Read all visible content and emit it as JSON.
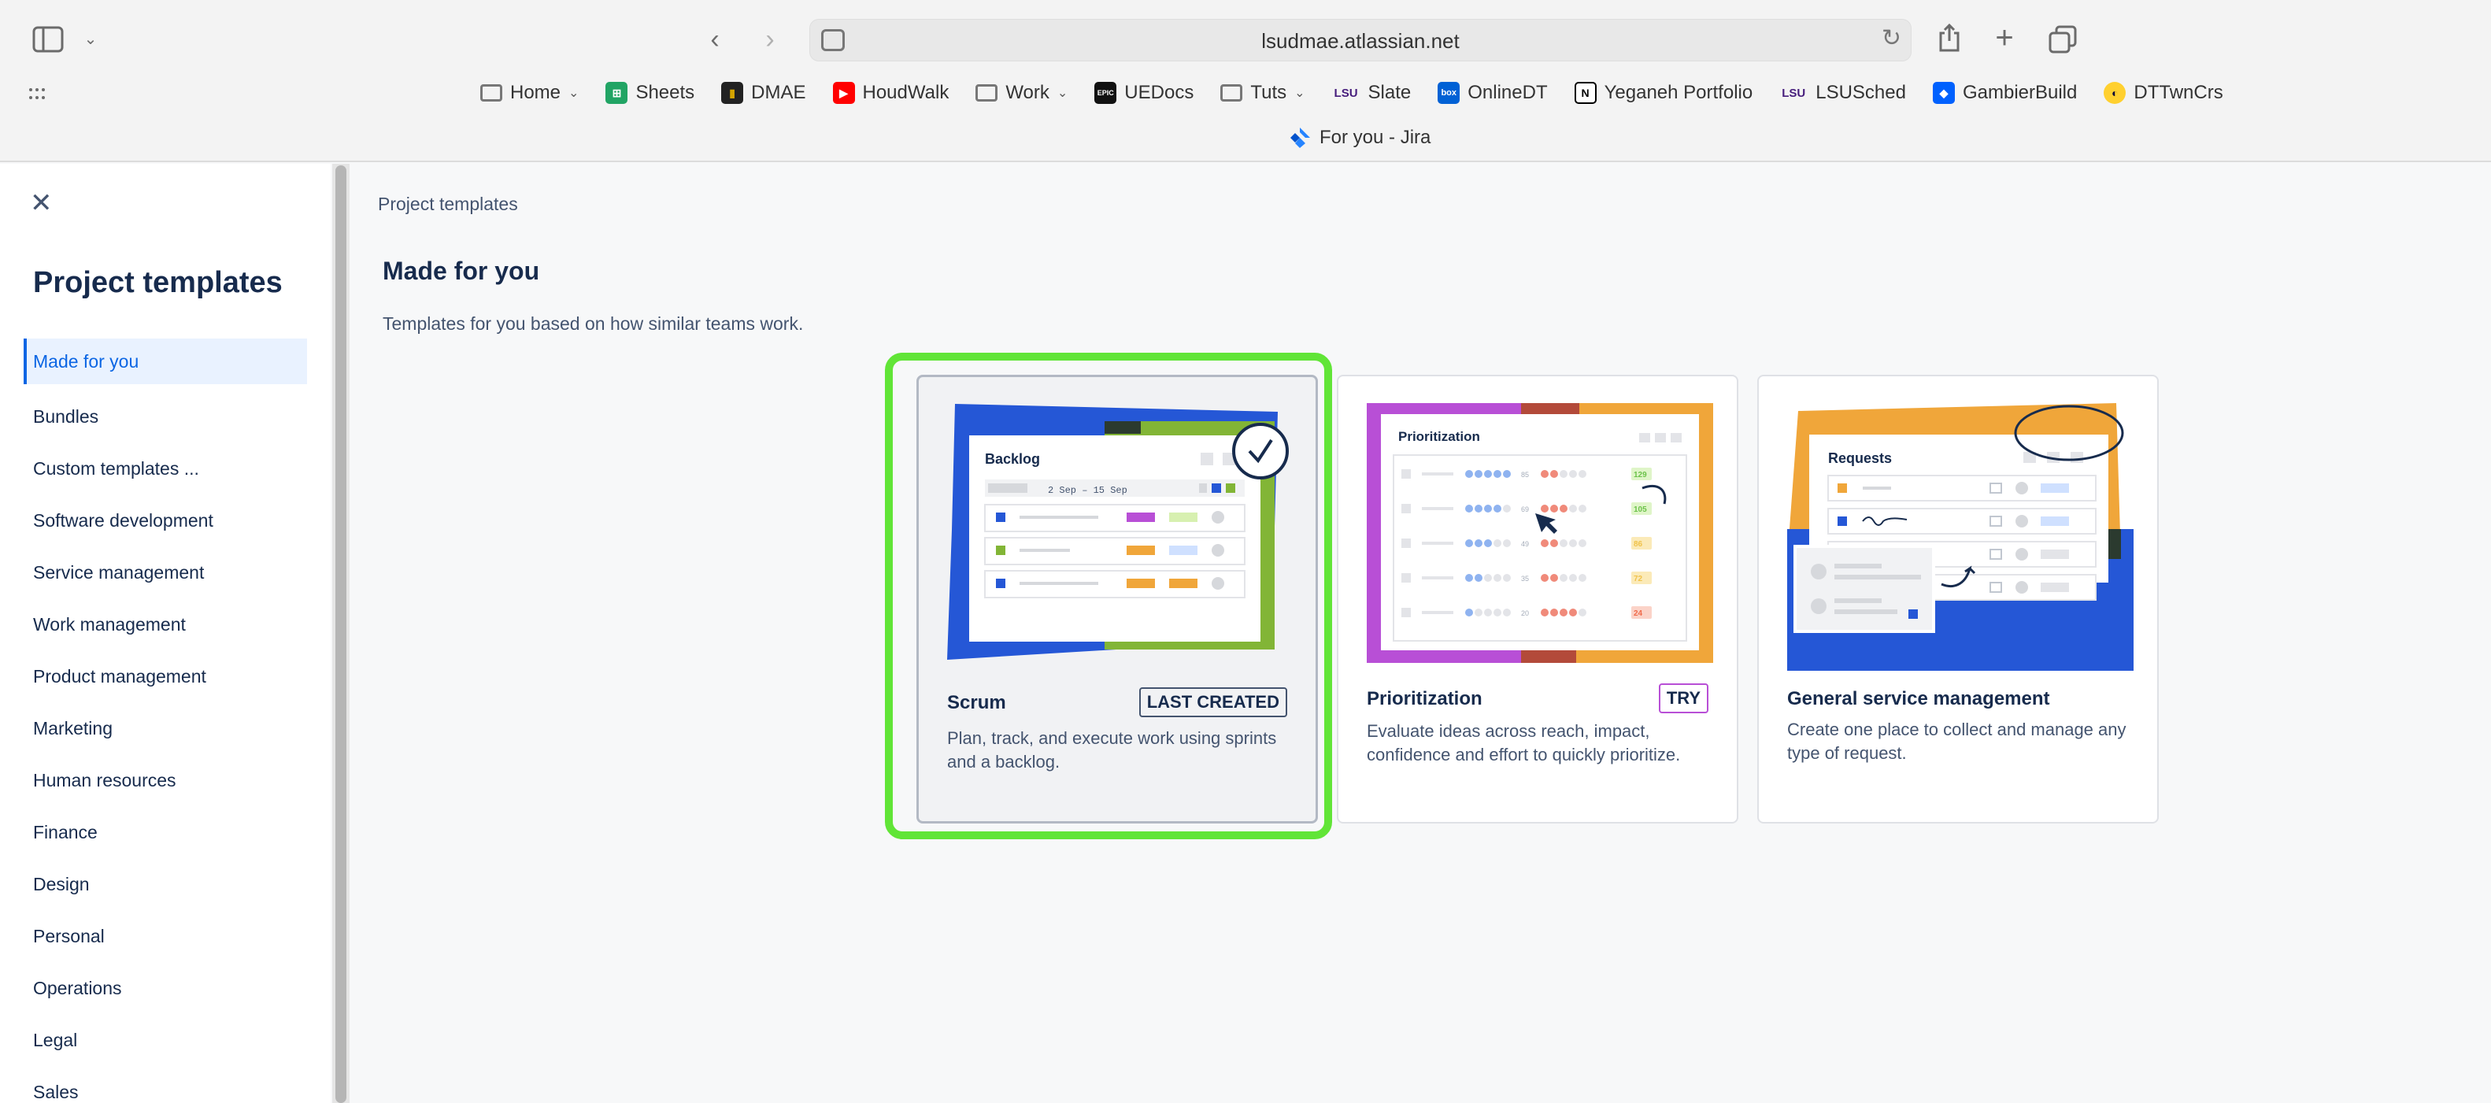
{
  "browser": {
    "url": "lsudmae.atlassian.net",
    "bookmarks": [
      {
        "label": "Home",
        "icon": "folder-icon",
        "has_menu": true
      },
      {
        "label": "Sheets",
        "icon": "sheets-icon",
        "has_menu": false
      },
      {
        "label": "DMAE",
        "icon": "dmae-icon",
        "has_menu": false
      },
      {
        "label": "HoudWalk",
        "icon": "youtube-icon",
        "has_menu": false
      },
      {
        "label": "Work",
        "icon": "folder-icon",
        "has_menu": true
      },
      {
        "label": "UEDocs",
        "icon": "epic-icon",
        "has_menu": false
      },
      {
        "label": "Tuts",
        "icon": "folder-icon",
        "has_menu": true
      },
      {
        "label": "Slate",
        "icon": "lsu-icon",
        "has_menu": false
      },
      {
        "label": "OnlineDT",
        "icon": "box-icon",
        "has_menu": false
      },
      {
        "label": "Yeganeh Portfolio",
        "icon": "notion-icon",
        "has_menu": false
      },
      {
        "label": "LSUSched",
        "icon": "lsu-icon",
        "has_menu": false
      },
      {
        "label": "GambierBuild",
        "icon": "dropbox-icon",
        "has_menu": false
      },
      {
        "label": "DTTwnCrs",
        "icon": "miro-icon",
        "has_menu": false
      }
    ],
    "tab_title": "For you - Jira"
  },
  "sidebar": {
    "title": "Project templates",
    "items": [
      {
        "label": "Made for you",
        "active": true
      },
      {
        "label": "Bundles"
      },
      {
        "label": "Custom templates ..."
      },
      {
        "label": "Software development"
      },
      {
        "label": "Service management"
      },
      {
        "label": "Work management"
      },
      {
        "label": "Product management"
      },
      {
        "label": "Marketing"
      },
      {
        "label": "Human resources"
      },
      {
        "label": "Finance"
      },
      {
        "label": "Design"
      },
      {
        "label": "Personal"
      },
      {
        "label": "Operations"
      },
      {
        "label": "Legal"
      },
      {
        "label": "Sales"
      }
    ]
  },
  "main": {
    "breadcrumb": "Project templates",
    "heading": "Made for you",
    "description": "Templates for you based on how similar teams work.",
    "cards": [
      {
        "name": "Scrum",
        "badge": "LAST CREATED",
        "description": "Plan, track, and execute work using sprints and a backlog.",
        "illustration": {
          "title": "Backlog",
          "subtitle": "2 Sep – 15 Sep"
        }
      },
      {
        "name": "Prioritization",
        "badge": "TRY",
        "description": "Evaluate ideas across reach, impact, confidence and effort to quickly prioritize.",
        "illustration": {
          "title": "Prioritization",
          "scores": [
            "129",
            "105",
            "86",
            "72",
            "24"
          ],
          "values": [
            "85",
            "69",
            "49",
            "35",
            "20"
          ]
        }
      },
      {
        "name": "General service management",
        "badge": "",
        "description": "Create one place to collect and manage any type of request.",
        "illustration": {
          "title": "Requests"
        }
      }
    ]
  },
  "colors": {
    "highlight": "#61e537",
    "accent": "#0c66e4",
    "scrum_blue": "#2557d6",
    "scrum_green": "#82b536",
    "prio_purple": "#b84fd6",
    "prio_orange": "#f0a63a",
    "gsm_orange": "#f0a63a",
    "gsm_blue": "#2557d6"
  }
}
